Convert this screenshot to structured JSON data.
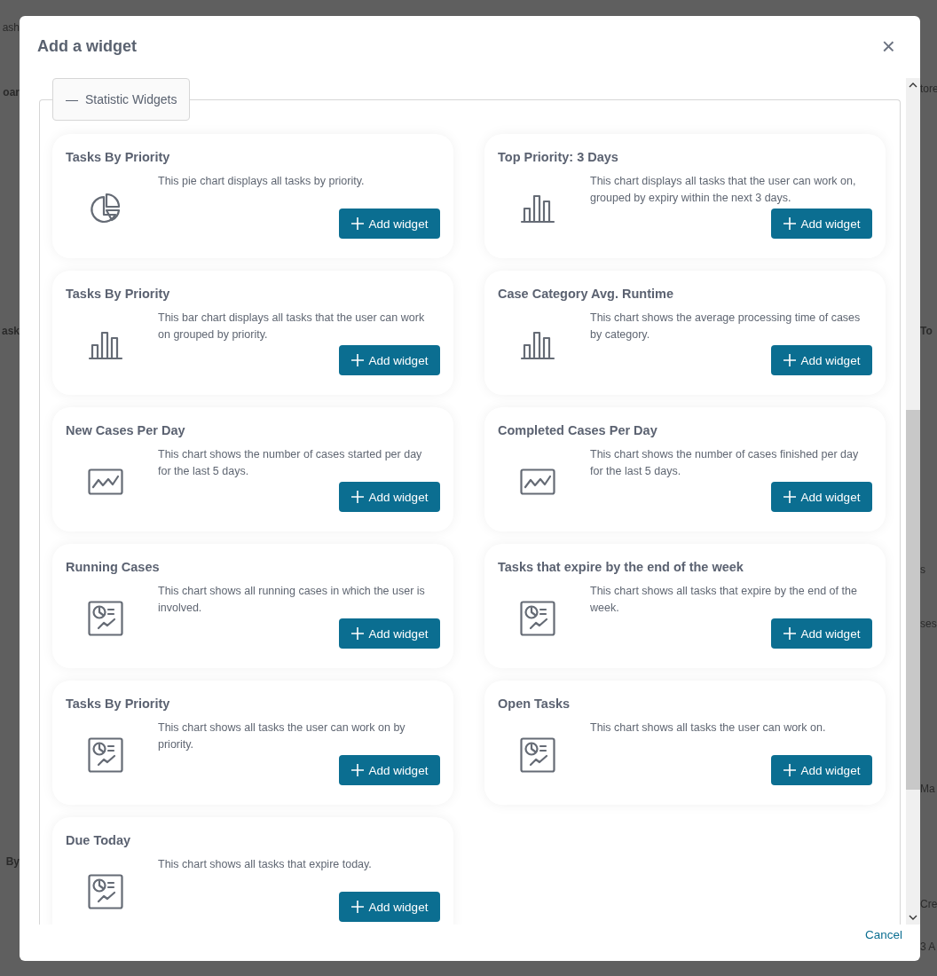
{
  "background_page": {
    "left_fragments": [
      "ash",
      "oar",
      "ask",
      "By"
    ],
    "right_fragments": [
      "tore",
      "To",
      "s",
      "ses",
      "Ma",
      "Cre",
      "3 A"
    ]
  },
  "dialog": {
    "title": "Add a widget",
    "close_label": "×",
    "cancel_label": "Cancel"
  },
  "section": {
    "toggle": "—",
    "title": "Statistic Widgets",
    "expanded": true
  },
  "widgets": [
    {
      "title": "Tasks By Priority",
      "description": "This pie chart displays all tasks by priority.",
      "kind": "pie",
      "button": "Add widget"
    },
    {
      "title": "Top Priority: 3 Days",
      "description": "This chart displays all tasks that the user can work on, grouped by expiry within the next 3 days.",
      "kind": "bar",
      "button": "Add widget"
    },
    {
      "title": "Tasks By Priority",
      "description": "This bar chart displays all tasks that the user can work on grouped by priority.",
      "kind": "bar",
      "button": "Add widget"
    },
    {
      "title": "Case Category Avg. Runtime",
      "description": "This chart shows the average processing time of cases by category.",
      "kind": "bar",
      "button": "Add widget"
    },
    {
      "title": "New Cases Per Day",
      "description": "This chart shows the number of cases started per day for the last 5 days.",
      "kind": "line",
      "button": "Add widget"
    },
    {
      "title": "Completed Cases Per Day",
      "description": "This chart shows the number of cases finished per day for the last 5 days.",
      "kind": "line",
      "button": "Add widget"
    },
    {
      "title": "Running Cases",
      "description": "This chart shows all running cases in which the user is involved.",
      "kind": "dashboard",
      "button": "Add widget"
    },
    {
      "title": "Tasks that expire by the end of the week",
      "description": "This chart shows all tasks that expire by the end of the week.",
      "kind": "dashboard",
      "button": "Add widget"
    },
    {
      "title": "Tasks By Priority",
      "description": "This chart shows all tasks the user can work on by priority.",
      "kind": "dashboard",
      "button": "Add widget"
    },
    {
      "title": "Open Tasks",
      "description": "This chart shows all tasks the user can work on.",
      "kind": "dashboard",
      "button": "Add widget"
    },
    {
      "title": "Due Today",
      "description": "This chart shows all tasks that expire today.",
      "kind": "dashboard",
      "button": "Add widget"
    }
  ]
}
